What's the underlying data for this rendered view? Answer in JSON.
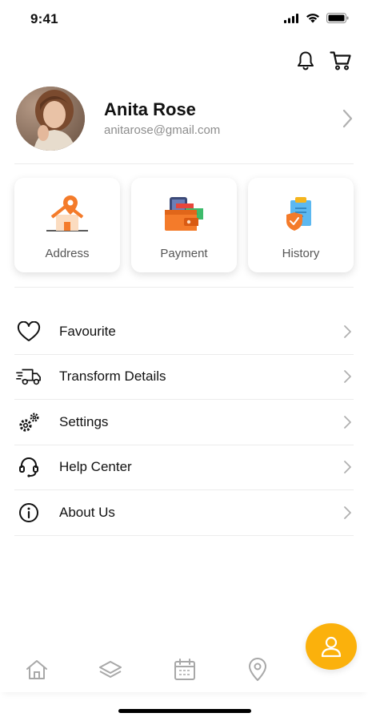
{
  "status_bar": {
    "time": "9:41"
  },
  "profile": {
    "name": "Anita Rose",
    "email": "anitarose@gmail.com"
  },
  "cards": [
    {
      "label": "Address",
      "icon": "house-location-icon"
    },
    {
      "label": "Payment",
      "icon": "wallet-icon"
    },
    {
      "label": "History",
      "icon": "clipboard-icon"
    }
  ],
  "menu": [
    {
      "label": "Favourite",
      "icon": "heart-icon"
    },
    {
      "label": "Transform Details",
      "icon": "delivery-truck-icon"
    },
    {
      "label": "Settings",
      "icon": "gears-icon"
    },
    {
      "label": "Help Center",
      "icon": "headset-icon"
    },
    {
      "label": "About Us",
      "icon": "info-icon"
    }
  ],
  "bottom_nav": [
    "home-icon",
    "layers-icon",
    "calendar-icon",
    "location-pin-icon",
    "user-icon"
  ],
  "colors": {
    "accent": "#fbb10c",
    "orange": "#f47b2a",
    "text": "#111111",
    "muted": "#8d8d8d"
  }
}
